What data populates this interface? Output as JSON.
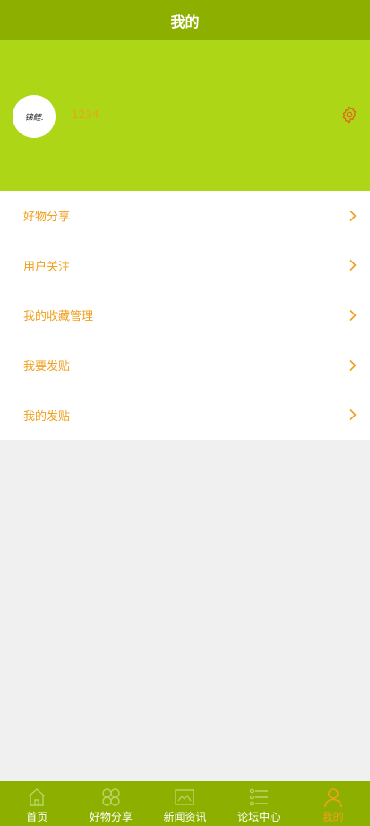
{
  "header": {
    "title": "我的"
  },
  "profile": {
    "avatar_text": "锦鲤.",
    "username": "1234"
  },
  "menu": {
    "items": [
      {
        "label": "好物分享"
      },
      {
        "label": "用户关注"
      },
      {
        "label": "我的收藏管理"
      },
      {
        "label": "我要发贴"
      },
      {
        "label": "我的发贴"
      }
    ]
  },
  "tabbar": {
    "tabs": [
      {
        "label": "首页",
        "icon": "home-icon"
      },
      {
        "label": "好物分享",
        "icon": "grid-icon"
      },
      {
        "label": "新闻资讯",
        "icon": "news-icon"
      },
      {
        "label": "论坛中心",
        "icon": "list-icon"
      },
      {
        "label": "我的",
        "icon": "user-icon",
        "active": true
      }
    ]
  },
  "colors": {
    "header": "#8db000",
    "profile_bg": "#add617",
    "accent": "#f0a01e",
    "gear": "#e0651b",
    "tab_icon": "#b8d66a"
  }
}
